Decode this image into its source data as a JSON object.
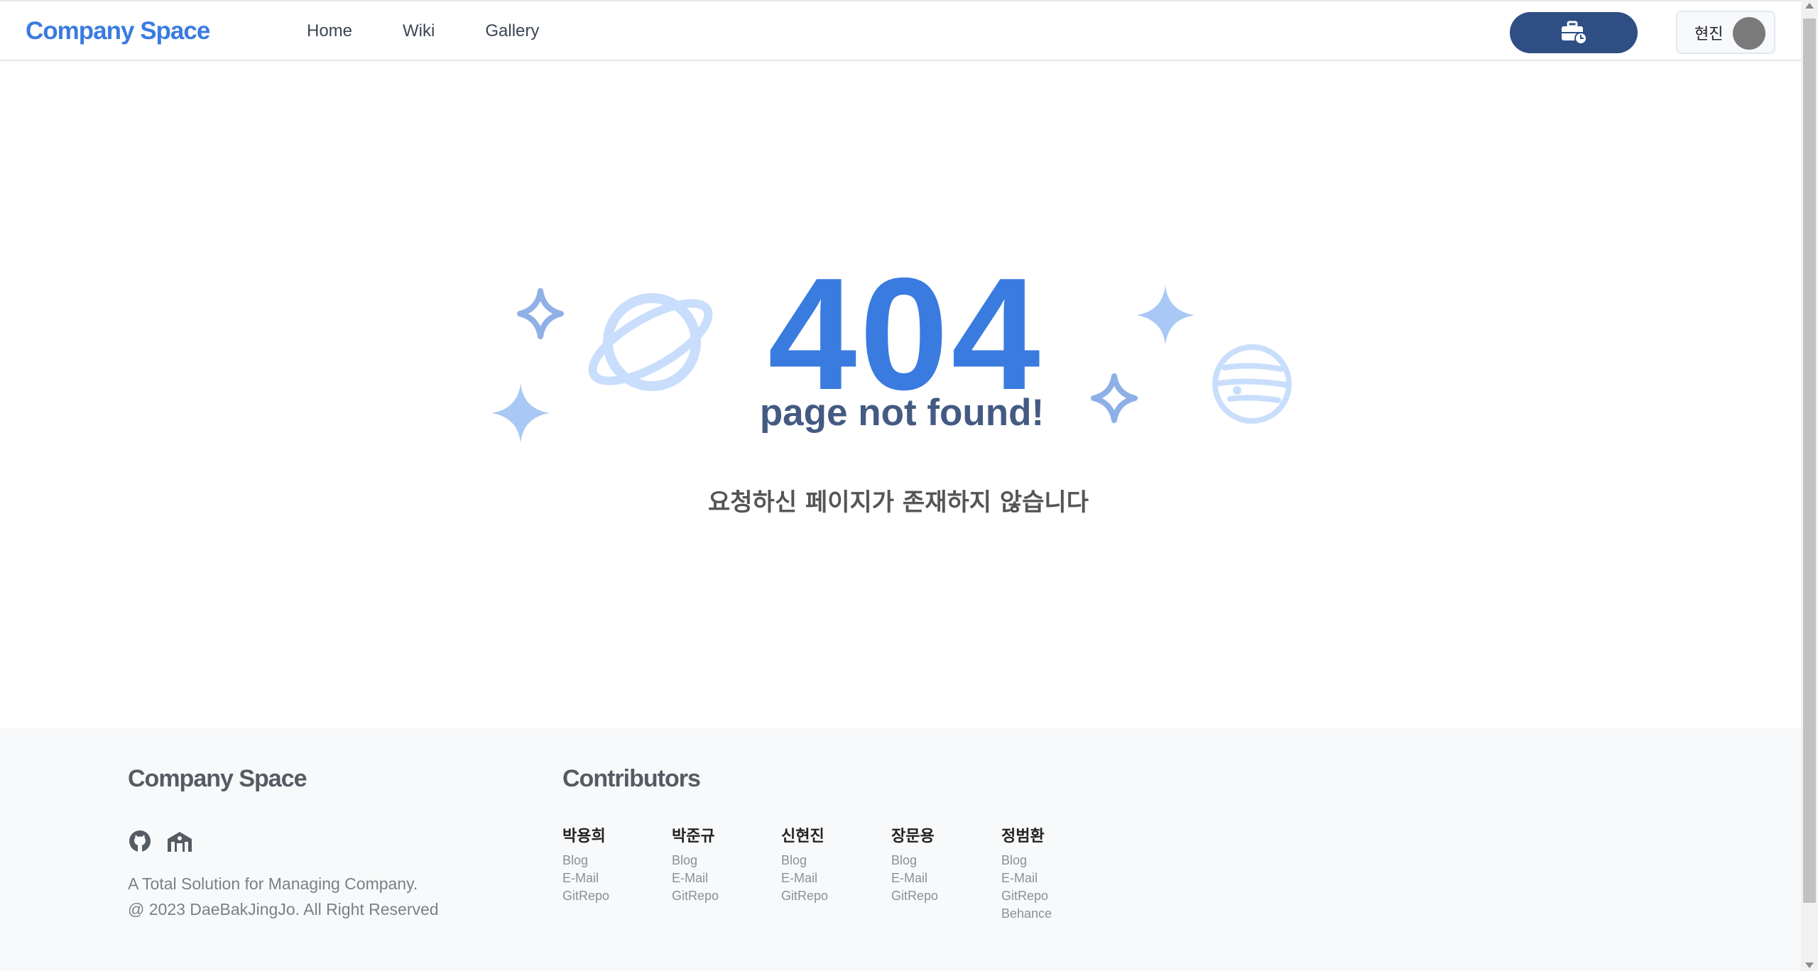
{
  "header": {
    "logo": "Company Space",
    "nav": [
      "Home",
      "Wiki",
      "Gallery"
    ],
    "user_name": "현진"
  },
  "main": {
    "code": "404",
    "title": "page not found!",
    "message": "요청하신 페이지가 존재하지 않습니다"
  },
  "footer": {
    "logo": "Company Space",
    "description": "A Total Solution for Managing Company.",
    "copyright": "@ 2023 DaeBakJingJo. All Right Reserved",
    "contributors_title": "Contributors",
    "contributors": [
      {
        "name": "박용희",
        "links": [
          "Blog",
          "E-Mail",
          "GitRepo"
        ]
      },
      {
        "name": "박준규",
        "links": [
          "Blog",
          "E-Mail",
          "GitRepo"
        ]
      },
      {
        "name": "신현진",
        "links": [
          "Blog",
          "E-Mail",
          "GitRepo"
        ]
      },
      {
        "name": "장문용",
        "links": [
          "Blog",
          "E-Mail",
          "GitRepo"
        ]
      },
      {
        "name": "정범환",
        "links": [
          "Blog",
          "E-Mail",
          "GitRepo",
          "Behance"
        ]
      }
    ]
  },
  "colors": {
    "accent": "#3a7be0",
    "button": "#2e4e84",
    "title": "#445a82",
    "decor_light": "#a9c8f5",
    "decor_mid": "#8fb0e6"
  },
  "icons": [
    "briefcase-clock-icon",
    "github-icon",
    "building-icon",
    "planet-icon",
    "sparkle-icon",
    "globe-icon"
  ]
}
